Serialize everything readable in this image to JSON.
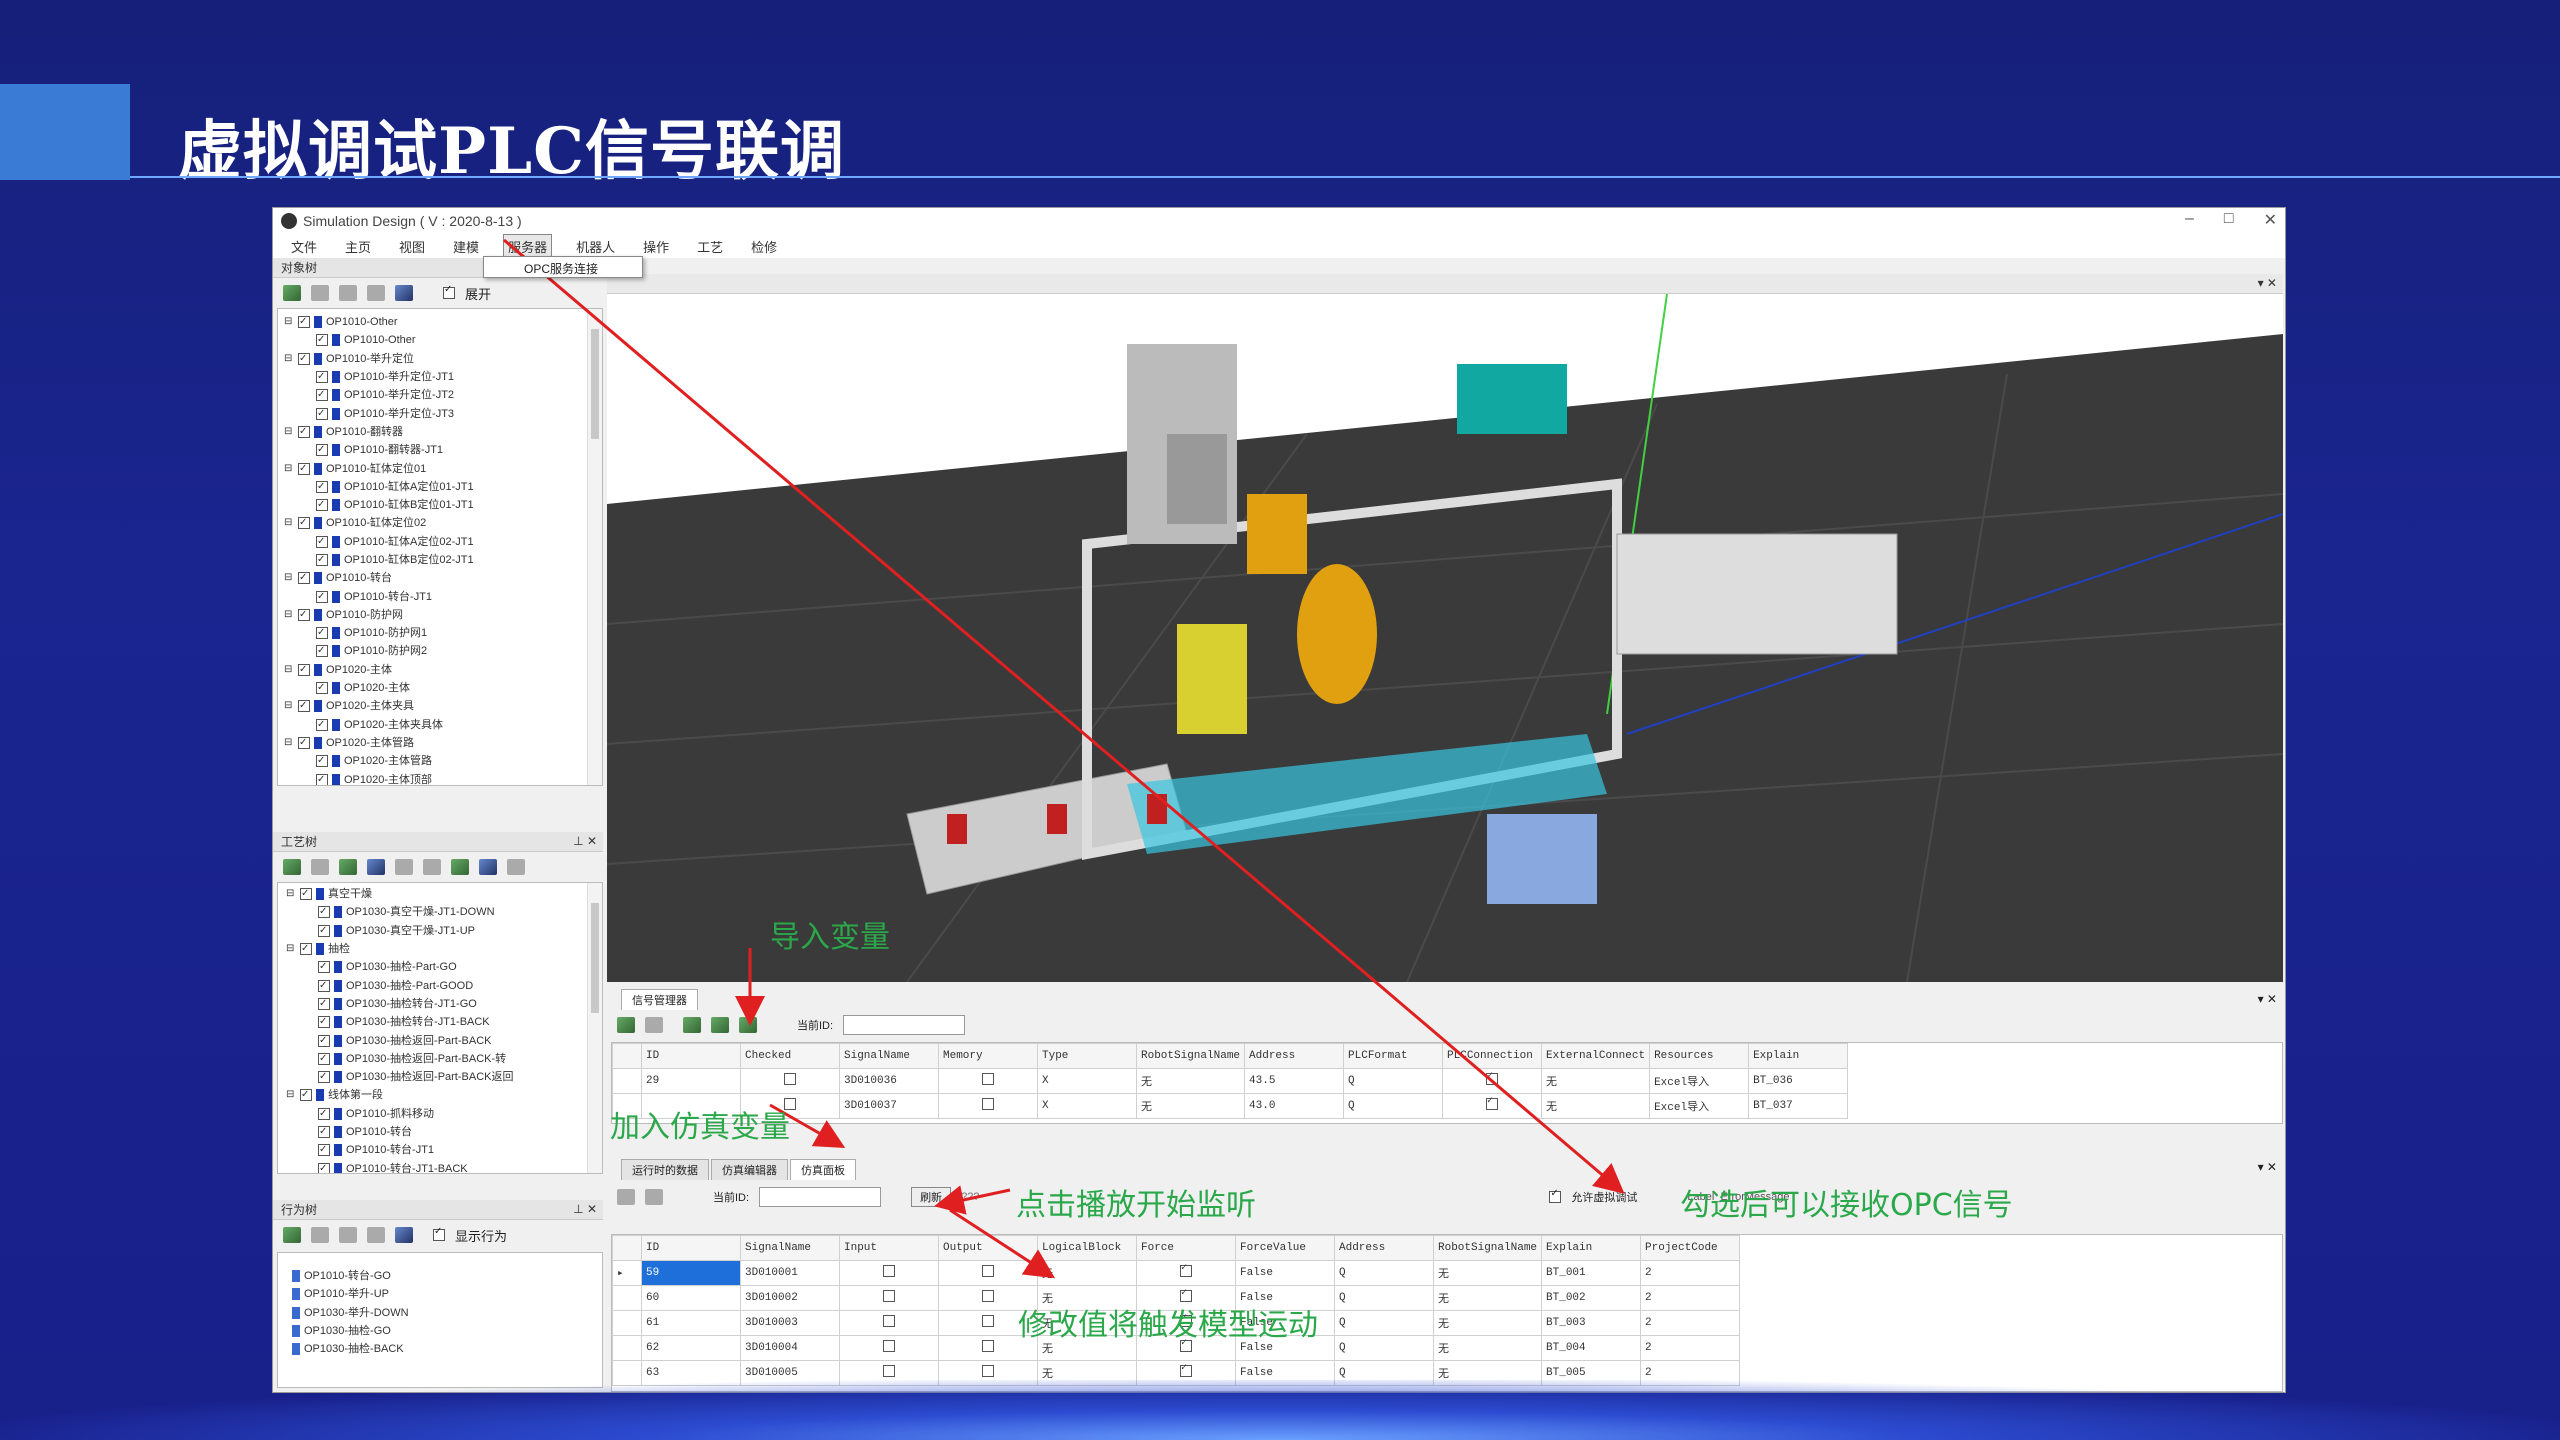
{
  "slide": {
    "title": "虚拟调试PLC信号联调"
  },
  "window": {
    "title": "Simulation Design ( V : 2020-8-13 )",
    "controls": {
      "minimize": "–",
      "maximize": "□",
      "close": "✕"
    }
  },
  "menu": {
    "items": [
      "文件",
      "主页",
      "视图",
      "建模",
      "服务器",
      "机器人",
      "操作",
      "工艺",
      "检修"
    ],
    "active": "服务器"
  },
  "dropdown": {
    "item": "OPC服务连接"
  },
  "object_panel": {
    "title": "对象树",
    "expand_label": "展开",
    "tree": [
      "OP1010-Other",
      "OP1010-Other",
      "OP1010-举升定位",
      "OP1010-举升定位-JT1",
      "OP1010-举升定位-JT2",
      "OP1010-举升定位-JT3",
      "OP1010-翻转器",
      "OP1010-翻转器-JT1",
      "OP1010-缸体定位01",
      "OP1010-缸体A定位01-JT1",
      "OP1010-缸体B定位01-JT1",
      "OP1010-缸体定位02",
      "OP1010-缸体A定位02-JT1",
      "OP1010-缸体B定位02-JT1",
      "OP1010-转台",
      "OP1010-转台-JT1",
      "OP1010-防护网",
      "OP1010-防护网1",
      "OP1010-防护网2",
      "OP1020-主体",
      "OP1020-主体",
      "OP1020-主体夹具",
      "OP1020-主体夹具体",
      "OP1020-主体管路",
      "OP1020-主体管路",
      "OP1020-主体顶部"
    ]
  },
  "process_panel": {
    "title": "工艺树",
    "tree": [
      "真空干燥",
      "OP1030-真空干燥-JT1-DOWN",
      "OP1030-真空干燥-JT1-UP",
      "抽检",
      "OP1030-抽检-Part-GO",
      "OP1030-抽检-Part-GOOD",
      "OP1030-抽检转台-JT1-GO",
      "OP1030-抽检转台-JT1-BACK",
      "OP1030-抽检返回-Part-BACK",
      "OP1030-抽检返回-Part-BACK-转",
      "OP1030-抽检返回-Part-BACK返回",
      "线体第一段",
      "OP1010-抓料移动",
      "OP1010-转台",
      "OP1010-转台-JT1",
      "OP1010-转台-JT1-BACK"
    ]
  },
  "behavior_panel": {
    "title": "行为树",
    "show_label": "显示行为",
    "tree": [
      "OP1010-转台-GO",
      "OP1010-举升-UP",
      "OP1030-举升-DOWN",
      "OP1030-抽检-GO",
      "OP1030-抽检-BACK"
    ]
  },
  "signal_mgr": {
    "tab": "信号管理器",
    "search_label": "当前ID:",
    "columns": [
      "ID",
      "Checked",
      "SignalName",
      "Memory",
      "Type",
      "RobotSignalName",
      "Address",
      "PLCFormat",
      "PLCConnection",
      "ExternalConnect",
      "Resources",
      "Explain"
    ],
    "rows": [
      [
        "29",
        "",
        "3D010036",
        "",
        "X",
        "无",
        "43.5",
        "Q",
        "",
        "无",
        "Excel导入",
        "BT_036"
      ],
      [
        "",
        "",
        "3D010037",
        "",
        "X",
        "无",
        "43.0",
        "Q",
        "",
        "无",
        "Excel导入",
        "BT_037"
      ]
    ]
  },
  "sim_panel": {
    "tabs": [
      "运行时的数据",
      "仿真编辑器",
      "仿真面板"
    ],
    "search_label": "当前ID:",
    "refresh_button": "刷新",
    "hint": "???",
    "allow_label": "允许虚拟调试",
    "extra_label": "Label_ErrorMessage",
    "columns": [
      "ID",
      "SignalName",
      "Input",
      "Output",
      "LogicalBlock",
      "Force",
      "ForceValue",
      "Address",
      "RobotSignalName",
      "Explain",
      "ProjectCode"
    ],
    "rows": [
      [
        "59",
        "3D010001",
        "",
        "",
        "无",
        "",
        "False",
        "Q",
        "无",
        "BT_001",
        "2"
      ],
      [
        "60",
        "3D010002",
        "",
        "",
        "无",
        "",
        "False",
        "Q",
        "无",
        "BT_002",
        "2"
      ],
      [
        "61",
        "3D010003",
        "",
        "",
        "无",
        "",
        "False",
        "Q",
        "无",
        "BT_003",
        "2"
      ],
      [
        "62",
        "3D010004",
        "",
        "",
        "无",
        "",
        "False",
        "Q",
        "无",
        "BT_004",
        "2"
      ],
      [
        "63",
        "3D010005",
        "",
        "",
        "无",
        "",
        "False",
        "Q",
        "无",
        "BT_005",
        "2"
      ]
    ]
  },
  "annotations": {
    "import": "导入变量",
    "add": "加入仿真变量",
    "play": "点击播放开始监听",
    "opc": "勾选后可以接收OPC信号",
    "modify": "修改值将触发模型运动"
  },
  "colors": {
    "annotation": "#2aa84a",
    "arrow": "#e02020",
    "slide_bg": "#1a2590",
    "accent": "#3a7bd5"
  }
}
